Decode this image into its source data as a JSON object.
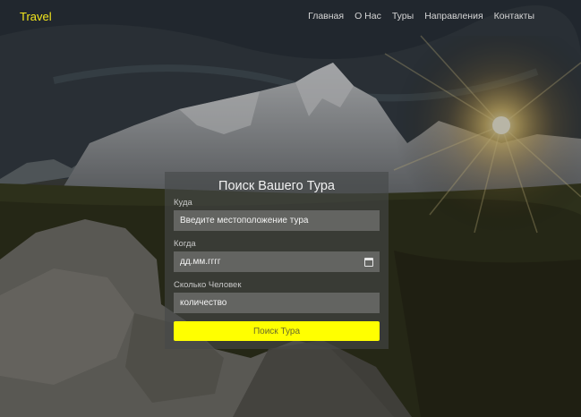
{
  "brand": "Travel",
  "nav": [
    "Главная",
    "О Нас",
    "Туры",
    "Направления",
    "Контакты"
  ],
  "form": {
    "title": "Поиск Вашего Тура",
    "where_label": "Куда",
    "where_placeholder": "Введите местоположение тура",
    "when_label": "Когда",
    "when_placeholder": "дд.мм.гггг",
    "people_label": "Сколько Человек",
    "people_placeholder": "количество",
    "submit_label": "Поиск Тура"
  },
  "colors": {
    "accent": "#ffff00",
    "brand": "#f5e71c"
  }
}
